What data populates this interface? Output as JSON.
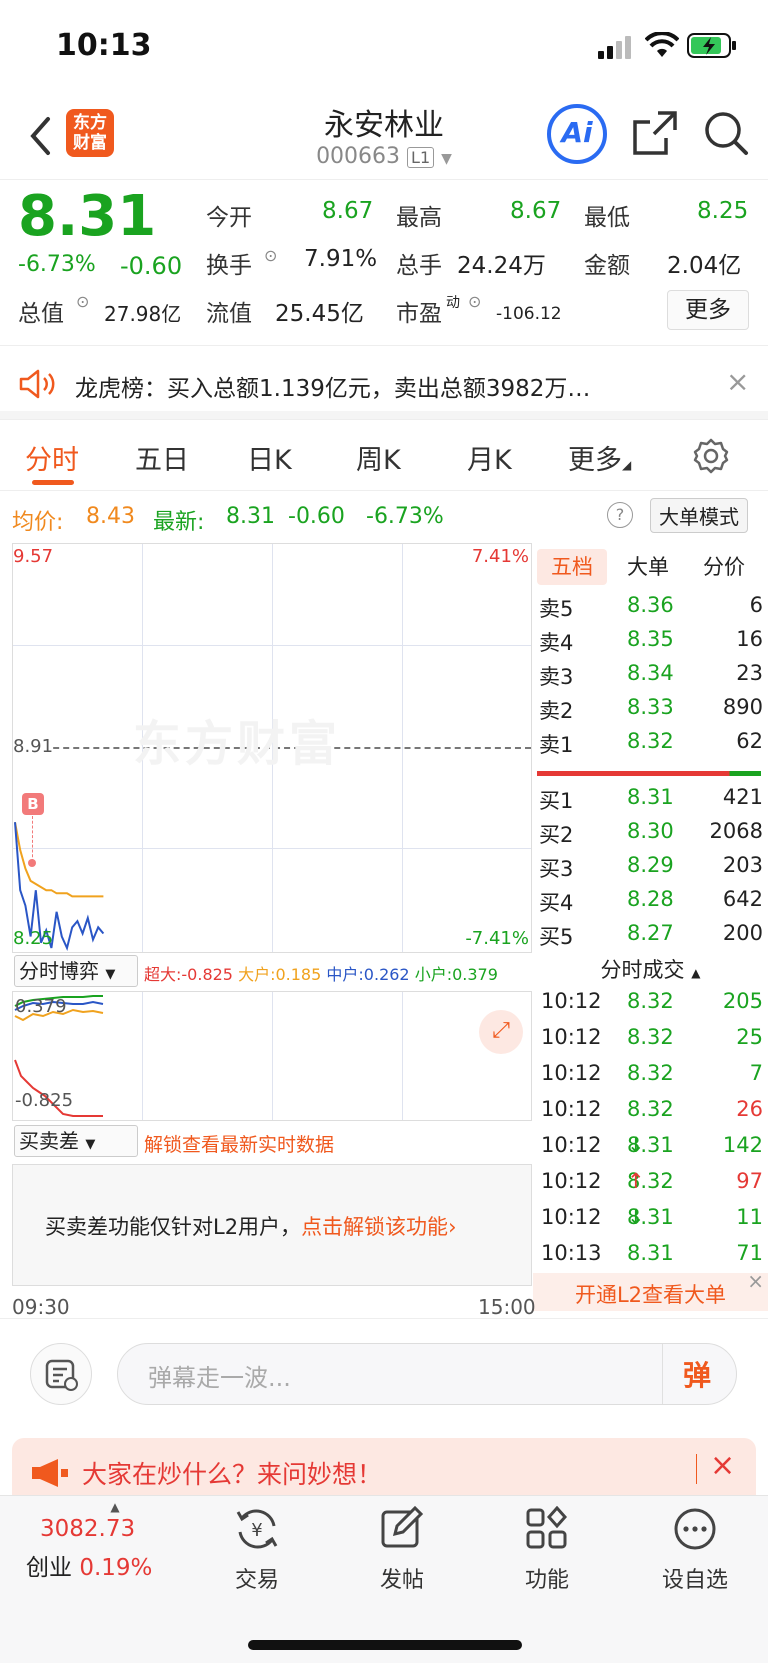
{
  "status_bar": {
    "time": "10:13"
  },
  "header": {
    "logo_text": "东方财富",
    "stock_name": "永安林业",
    "stock_code": "000663",
    "level_badge": "L1",
    "ai_label": "Ai"
  },
  "quote": {
    "price": "8.31",
    "change_pct": "-6.73%",
    "change": "-0.60",
    "fields": [
      {
        "label": "今开",
        "value": "8.67"
      },
      {
        "label": "最高",
        "value": "8.67"
      },
      {
        "label": "最低",
        "value": "8.25"
      },
      {
        "label": "换手",
        "value": "7.91%"
      },
      {
        "label": "总手",
        "value": "24.24万"
      },
      {
        "label": "金额",
        "value": "2.04亿"
      },
      {
        "label": "总值",
        "value": "27.98亿"
      },
      {
        "label": "流值",
        "value": "25.45亿"
      },
      {
        "label": "市盈",
        "sup": "动",
        "value": "-106.12"
      }
    ],
    "more_button": "更多"
  },
  "notice": {
    "text": "龙虎榜：买入总额1.139亿元，卖出总额3982万…"
  },
  "tabs": [
    "分时",
    "五日",
    "日K",
    "周K",
    "月K",
    "更多"
  ],
  "avg_line": {
    "avg_label": "均价:",
    "avg_value": "8.43",
    "latest_label": "最新:",
    "latest_value": "8.31",
    "latest_change": "-0.60",
    "latest_pct": "-6.73%",
    "help": "?",
    "big_order_mode": "大单模式"
  },
  "chart_data": {
    "type": "line",
    "title": "",
    "y_top": "9.57",
    "y_mid": "8.91",
    "y_bottom": "8.25",
    "pct_top": "7.41%",
    "pct_bottom": "-7.41%",
    "x_start": "09:30",
    "x_end": "15:00",
    "ylim": [
      8.25,
      9.57
    ],
    "buy_marker": "B",
    "series": [
      {
        "values": [
          8.67,
          8.45,
          8.4,
          8.3,
          8.45,
          8.28,
          8.32,
          8.25,
          8.38,
          8.3,
          8.26,
          8.33,
          8.35,
          8.31,
          8.36,
          8.29,
          8.33,
          8.31
        ]
      },
      {
        "values": [
          8.67,
          8.58,
          8.52,
          8.48,
          8.47,
          8.46,
          8.45,
          8.45,
          8.44,
          8.44,
          8.44,
          8.43,
          8.43,
          8.43,
          8.43,
          8.43,
          8.43,
          8.43
        ]
      }
    ],
    "watermark": "东方财富"
  },
  "depth": {
    "tabs": [
      "五档",
      "大单",
      "分价"
    ],
    "sell": [
      {
        "label": "卖5",
        "price": "8.36",
        "vol": "6"
      },
      {
        "label": "卖4",
        "price": "8.35",
        "vol": "16"
      },
      {
        "label": "卖3",
        "price": "8.34",
        "vol": "23"
      },
      {
        "label": "卖2",
        "price": "8.33",
        "vol": "890"
      },
      {
        "label": "卖1",
        "price": "8.32",
        "vol": "62"
      }
    ],
    "buy": [
      {
        "label": "买1",
        "price": "8.31",
        "vol": "421"
      },
      {
        "label": "买2",
        "price": "8.30",
        "vol": "2068"
      },
      {
        "label": "买3",
        "price": "8.29",
        "vol": "203"
      },
      {
        "label": "买4",
        "price": "8.28",
        "vol": "642"
      },
      {
        "label": "买5",
        "price": "8.27",
        "vol": "200"
      }
    ]
  },
  "indicator": {
    "select": "分时博弈",
    "values": [
      {
        "label": "超大:",
        "value": "-0.825",
        "color": "#e53935"
      },
      {
        "label": "大户:",
        "value": "0.185",
        "color": "#f0a21e"
      },
      {
        "label": "中户:",
        "value": "0.262",
        "color": "#2a56c6"
      },
      {
        "label": "小户:",
        "value": "0.379",
        "color": "#1aa320"
      }
    ],
    "axis_top": "0.379",
    "axis_bottom": "-0.825"
  },
  "trades": {
    "title": "分时成交",
    "rows": [
      {
        "time": "10:12",
        "price": "8.32",
        "arrow": "",
        "vol": "205",
        "color": "#1aa320"
      },
      {
        "time": "10:12",
        "price": "8.32",
        "arrow": "",
        "vol": "25",
        "color": "#1aa320"
      },
      {
        "time": "10:12",
        "price": "8.32",
        "arrow": "",
        "vol": "7",
        "color": "#1aa320"
      },
      {
        "time": "10:12",
        "price": "8.32",
        "arrow": "",
        "vol": "26",
        "color": "#e53935"
      },
      {
        "time": "10:12",
        "price": "8.31",
        "arrow": "↓",
        "vol": "142",
        "color": "#1aa320"
      },
      {
        "time": "10:12",
        "price": "8.32",
        "arrow": "↑",
        "vol": "97",
        "color": "#e53935"
      },
      {
        "time": "10:12",
        "price": "8.31",
        "arrow": "↓",
        "vol": "11",
        "color": "#1aa320"
      },
      {
        "time": "10:13",
        "price": "8.31",
        "arrow": "",
        "vol": "71",
        "color": "#1aa320"
      }
    ],
    "l2_prompt": "开通L2查看大单"
  },
  "buy_sell_diff": {
    "select": "买卖差",
    "unlock_hint": "解锁查看最新实时数据",
    "msg": "买卖差功能仅针对L2用户，",
    "msg_link": "点击解锁该功能"
  },
  "danmu": {
    "placeholder": "弹幕走一波...",
    "send": "弹"
  },
  "banner": {
    "text": "大家在炒什么？来问妙想！"
  },
  "bottom_bar": {
    "index_value": "3082.73",
    "index_name": "创业",
    "index_pct": "0.19%",
    "items": [
      "交易",
      "发帖",
      "功能",
      "设自选"
    ]
  }
}
